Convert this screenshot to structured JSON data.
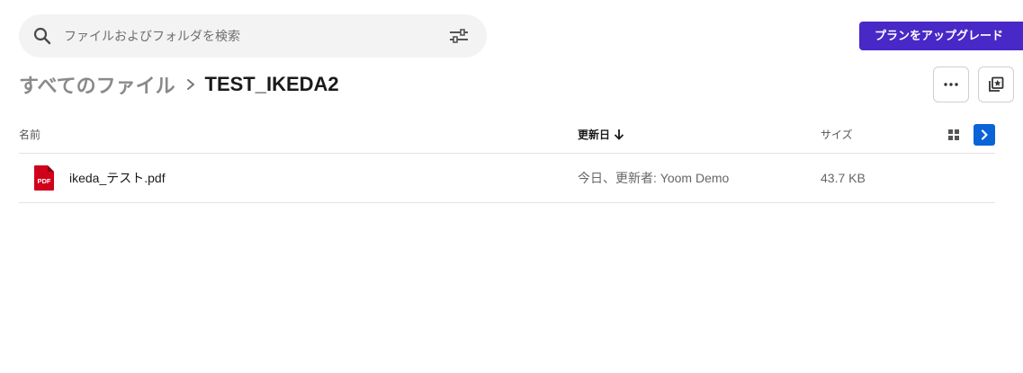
{
  "search": {
    "placeholder": "ファイルおよびフォルダを検索",
    "search_icon": "search-icon",
    "filter_icon": "filter-sliders-icon"
  },
  "header": {
    "upgrade_label": "プランをアップグレード",
    "accent_color": "#4828c6"
  },
  "breadcrumb": {
    "root": "すべてのファイル",
    "current": "TEST_IKEDA2",
    "separator_icon": "chevron-right-icon"
  },
  "actions": {
    "more_icon": "more-horizontal-icon",
    "star_icon": "starred-copy-icon"
  },
  "table": {
    "columns": {
      "name": "名前",
      "date": "更新日",
      "size": "サイズ"
    },
    "sort_icon": "arrow-down-icon",
    "view_icon": "grid-view-icon",
    "expand_icon": "chevron-right-icon",
    "expand_color": "#0b63d8",
    "rows": [
      {
        "icon": "pdf-file-icon",
        "icon_label": "PDF",
        "icon_color": "#d0021b",
        "name": "ikeda_テスト.pdf",
        "modified": "今日、更新者: Yoom Demo",
        "size": "43.7 KB"
      }
    ]
  }
}
